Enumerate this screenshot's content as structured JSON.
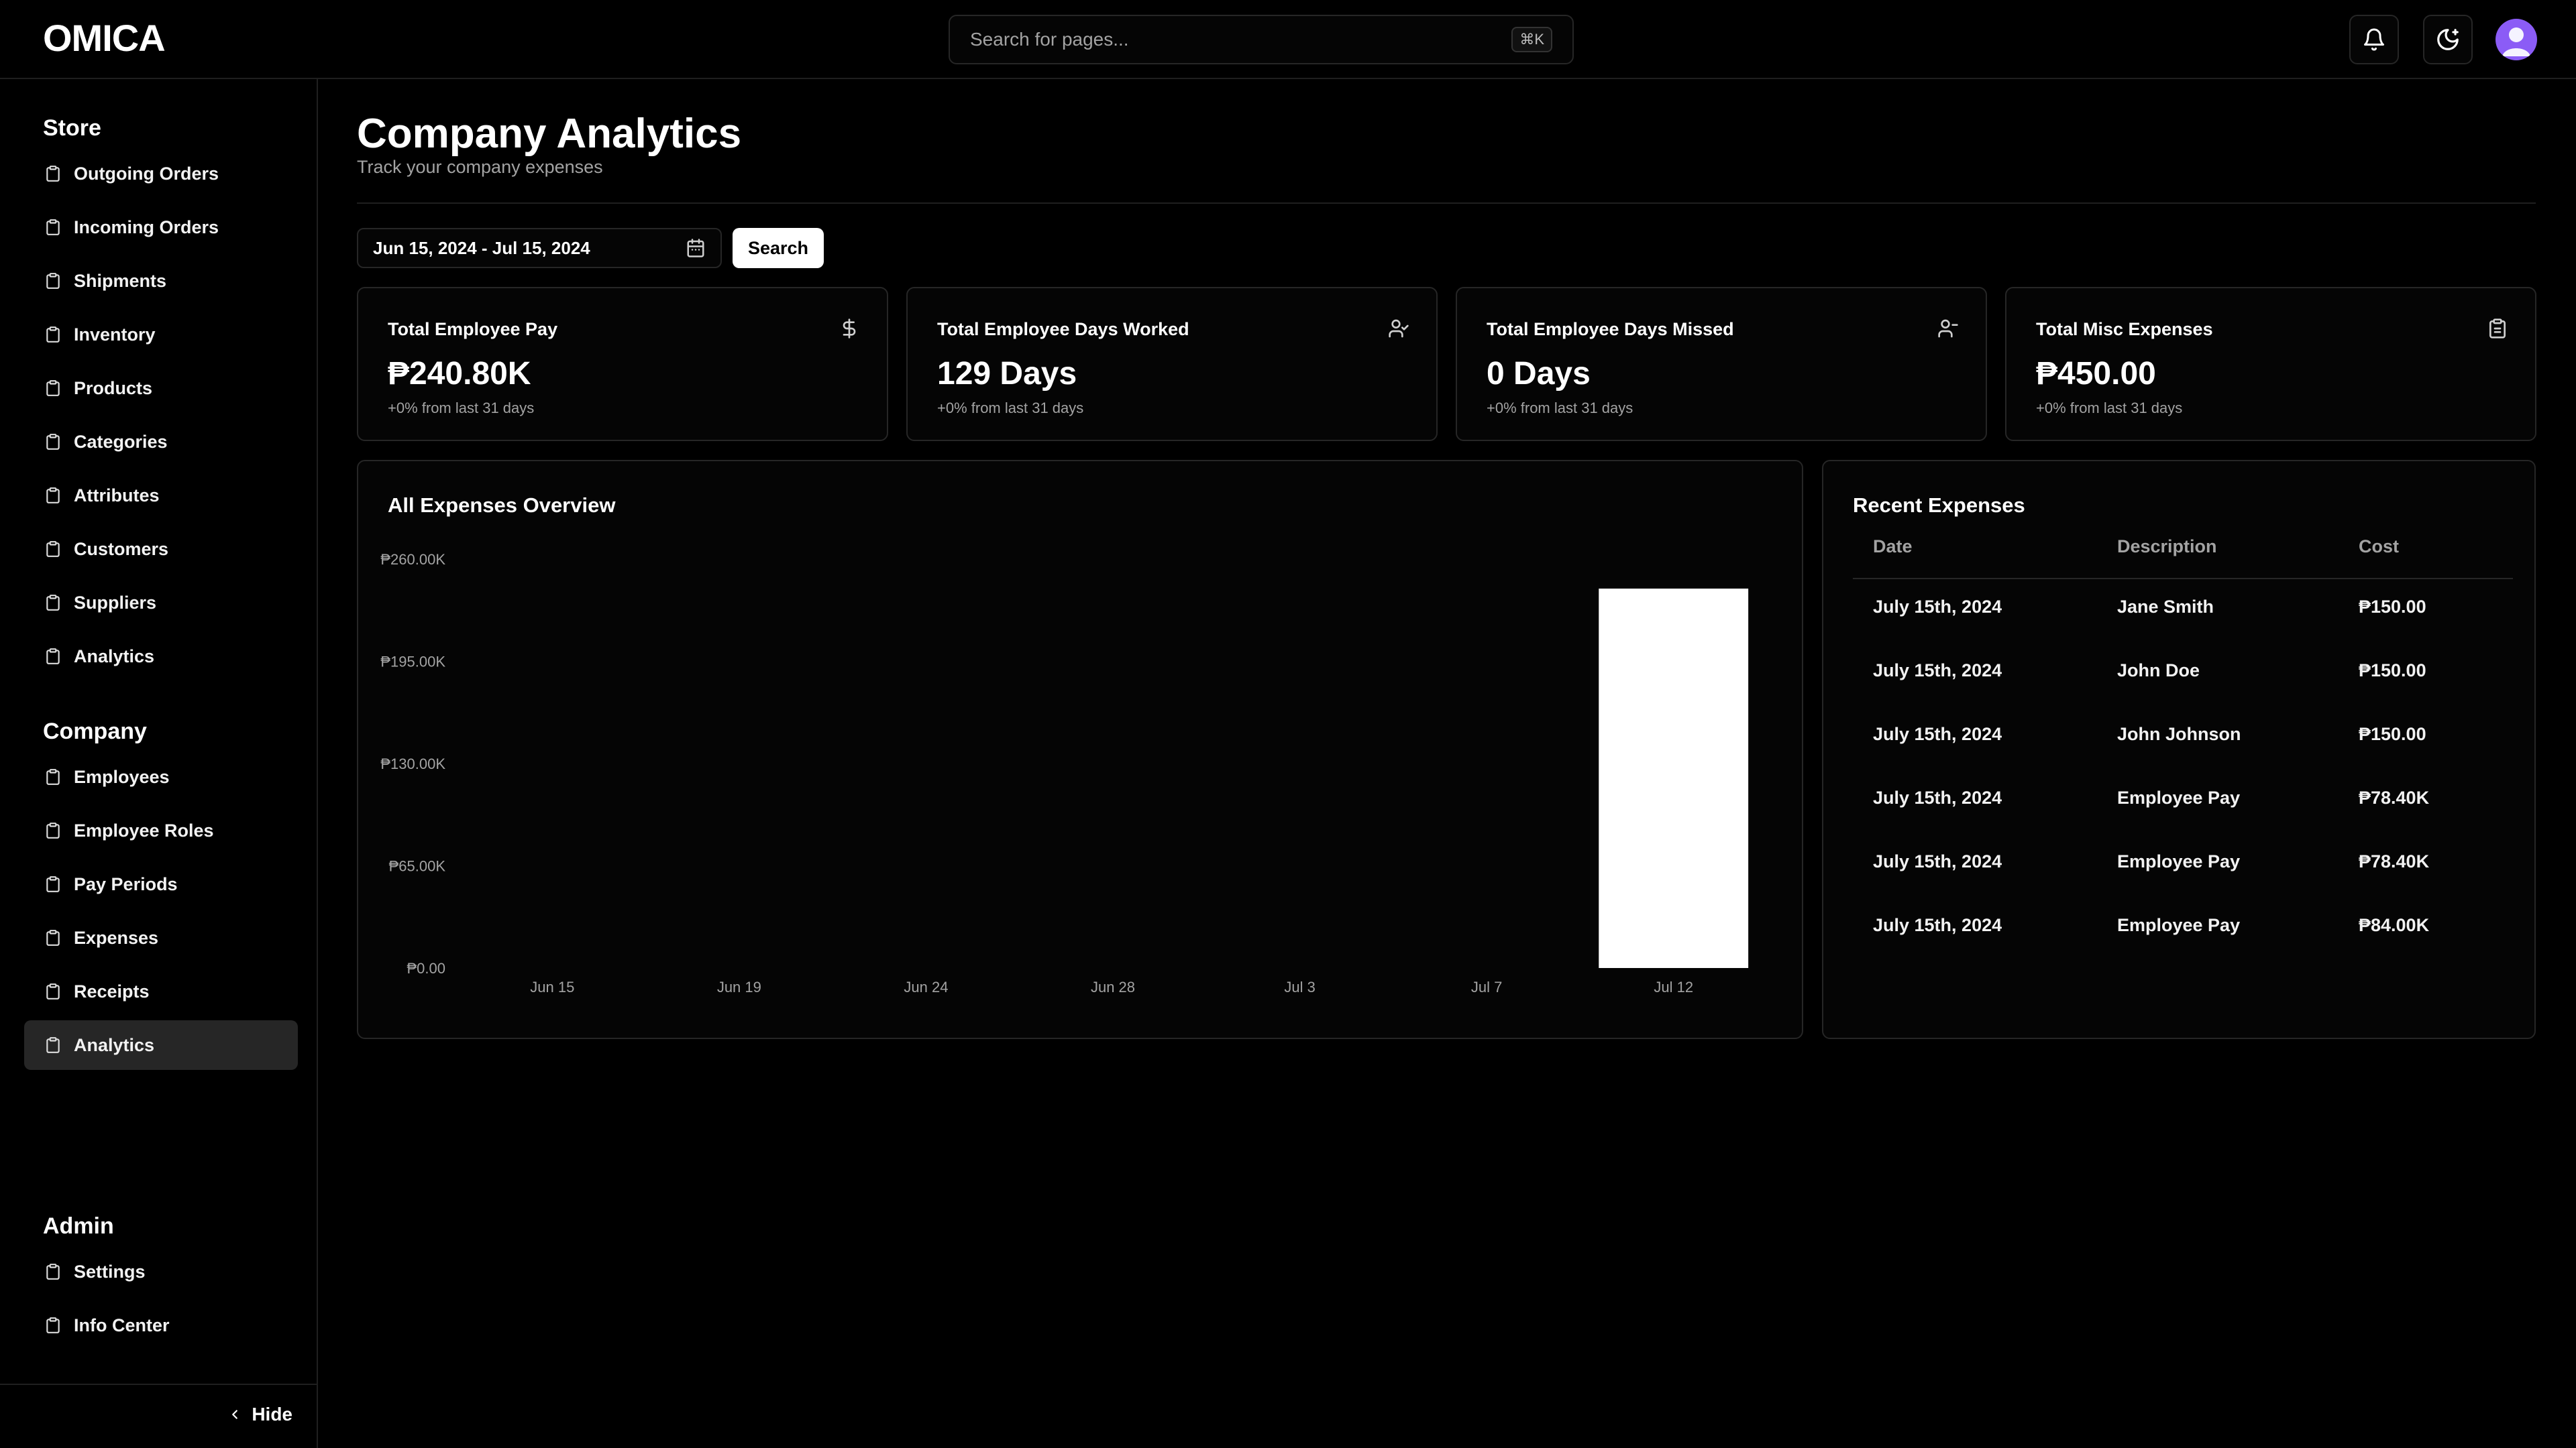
{
  "app": {
    "logo": "OMICA"
  },
  "header": {
    "search_placeholder": "Search for pages...",
    "search_shortcut": "⌘K",
    "icons": [
      "bell-icon",
      "theme-toggle-icon",
      "user-avatar-icon"
    ]
  },
  "sidebar": {
    "sections": [
      {
        "title": "Store",
        "items": [
          {
            "label": "Outgoing Orders",
            "icon": "clipboard-icon"
          },
          {
            "label": "Incoming Orders",
            "icon": "clipboard-icon"
          },
          {
            "label": "Shipments",
            "icon": "clipboard-icon"
          },
          {
            "label": "Inventory",
            "icon": "clipboard-icon"
          },
          {
            "label": "Products",
            "icon": "clipboard-icon"
          },
          {
            "label": "Categories",
            "icon": "clipboard-icon"
          },
          {
            "label": "Attributes",
            "icon": "clipboard-icon"
          },
          {
            "label": "Customers",
            "icon": "clipboard-icon"
          },
          {
            "label": "Suppliers",
            "icon": "clipboard-icon"
          },
          {
            "label": "Analytics",
            "icon": "clipboard-icon"
          }
        ]
      },
      {
        "title": "Company",
        "items": [
          {
            "label": "Employees",
            "icon": "clipboard-icon"
          },
          {
            "label": "Employee Roles",
            "icon": "clipboard-icon"
          },
          {
            "label": "Pay Periods",
            "icon": "clipboard-icon"
          },
          {
            "label": "Expenses",
            "icon": "clipboard-icon"
          },
          {
            "label": "Receipts",
            "icon": "clipboard-icon"
          },
          {
            "label": "Analytics",
            "icon": "clipboard-icon",
            "active": true
          }
        ]
      },
      {
        "title": "Admin",
        "items": [
          {
            "label": "Settings",
            "icon": "clipboard-icon"
          },
          {
            "label": "Info Center",
            "icon": "clipboard-icon"
          }
        ]
      }
    ],
    "hide_label": "Hide"
  },
  "page": {
    "title": "Company Analytics",
    "subtitle": "Track your company expenses",
    "date_range": "Jun 15, 2024 - Jul 15, 2024",
    "search_button": "Search"
  },
  "cards": [
    {
      "title": "Total Employee Pay",
      "value": "₱240.80K",
      "note": "+0% from last 31 days",
      "icon": "dollar-icon"
    },
    {
      "title": "Total Employee Days Worked",
      "value": "129 Days",
      "note": "+0% from last 31 days",
      "icon": "user-check-icon"
    },
    {
      "title": "Total Employee Days Missed",
      "value": "0 Days",
      "note": "+0% from last 31 days",
      "icon": "user-x-icon"
    },
    {
      "title": "Total Misc Expenses",
      "value": "₱450.00",
      "note": "+0% from last 31 days",
      "icon": "clipboard-icon"
    }
  ],
  "overview": {
    "title": "All Expenses Overview"
  },
  "chart_data": {
    "type": "bar",
    "title": "All Expenses Overview",
    "categories": [
      "Jun 15",
      "Jun 19",
      "Jun 24",
      "Jun 28",
      "Jul 3",
      "Jul 7",
      "Jul 12"
    ],
    "values": [
      0,
      0,
      0,
      0,
      0,
      0,
      241250
    ],
    "ylim": [
      0,
      260000
    ],
    "yticks": [
      0,
      65000,
      130000,
      195000,
      260000
    ],
    "ytick_labels": [
      "₱0.00",
      "₱65.00K",
      "₱130.00K",
      "₱195.00K",
      "₱260.00K"
    ],
    "bar_color": "#ffffff",
    "grid": false
  },
  "recent_expenses": {
    "title": "Recent Expenses",
    "columns": [
      "Date",
      "Description",
      "Cost"
    ],
    "rows": [
      [
        "July 15th, 2024",
        "Jane Smith",
        "₱150.00"
      ],
      [
        "July 15th, 2024",
        "John Doe",
        "₱150.00"
      ],
      [
        "July 15th, 2024",
        "John Johnson",
        "₱150.00"
      ],
      [
        "July 15th, 2024",
        "Employee Pay",
        "₱78.40K"
      ],
      [
        "July 15th, 2024",
        "Employee Pay",
        "₱78.40K"
      ],
      [
        "July 15th, 2024",
        "Employee Pay",
        "₱84.00K"
      ]
    ]
  }
}
